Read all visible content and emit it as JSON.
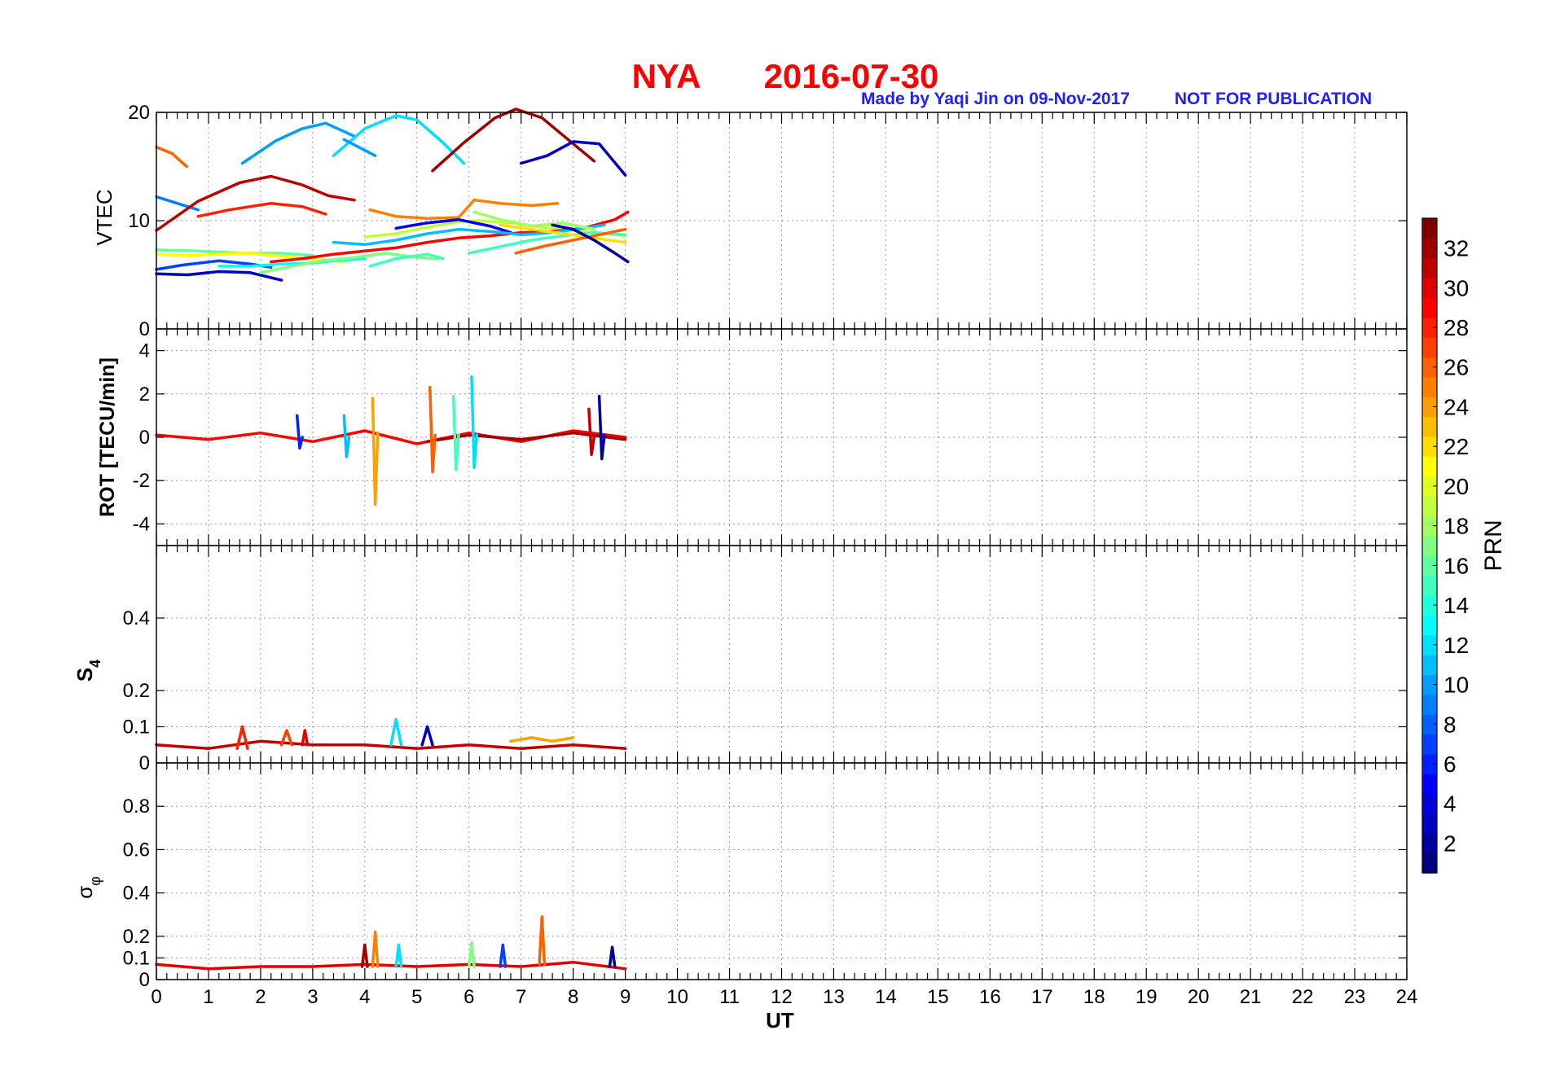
{
  "title": {
    "station": "NYA",
    "date": "2016-07-30",
    "credit": "Made by Yaqi Jin on 09-Nov-2017",
    "notice": "NOT FOR PUBLICATION",
    "color": "#ff0000",
    "credit_color": "#1f1fff"
  },
  "chart_data": {
    "type": "line",
    "x_axis": {
      "label": "UT",
      "range": [
        0,
        24
      ],
      "ticks": [
        0,
        1,
        2,
        3,
        4,
        5,
        6,
        7,
        8,
        9,
        10,
        11,
        12,
        13,
        14,
        15,
        16,
        17,
        18,
        19,
        20,
        21,
        22,
        23,
        24
      ],
      "data_coverage": [
        0,
        9.1
      ]
    },
    "grid": true,
    "colorbar": {
      "label": "PRN",
      "range": [
        1,
        33
      ],
      "ticks": [
        2,
        4,
        6,
        8,
        10,
        12,
        14,
        16,
        18,
        20,
        22,
        24,
        26,
        28,
        30,
        32
      ],
      "colormap": "jet",
      "position": "right"
    },
    "panels": [
      {
        "id": "vtec",
        "ylabel": "VTEC",
        "ylim": [
          0,
          20
        ],
        "yticks": [
          0,
          10,
          20
        ],
        "series": [
          {
            "prn": 26,
            "x": [
              0,
              0.3,
              0.58
            ],
            "y": [
              16.8,
              16.2,
              15.0
            ]
          },
          {
            "prn": 9,
            "x": [
              0,
              0.4,
              0.8
            ],
            "y": [
              12.2,
              11.6,
              11.0
            ]
          },
          {
            "prn": 28,
            "x": [
              0.8,
              1.4,
              2.2,
              2.8,
              3.25
            ],
            "y": [
              10.4,
              11.0,
              11.6,
              11.3,
              10.6
            ]
          },
          {
            "prn": 31,
            "x": [
              0,
              0.8,
              1.6,
              2.2,
              2.8,
              3.3,
              3.8
            ],
            "y": [
              9.1,
              11.8,
              13.5,
              14.1,
              13.3,
              12.3,
              11.9
            ]
          },
          {
            "prn": 10,
            "x": [
              1.65,
              2.3,
              2.8,
              3.25,
              3.8
            ],
            "y": [
              15.3,
              17.4,
              18.5,
              19.0,
              17.8
            ]
          },
          {
            "prn": 12,
            "x": [
              3.4,
              4.0,
              4.6,
              5.0,
              5.5,
              5.9
            ],
            "y": [
              16.0,
              18.5,
              19.7,
              19.3,
              17.2,
              15.3
            ]
          },
          {
            "prn": 10,
            "x": [
              3.6,
              4.2
            ],
            "y": [
              17.5,
              16.0
            ]
          },
          {
            "prn": 32,
            "x": [
              5.3,
              5.9,
              6.5,
              6.9,
              7.4,
              7.9,
              8.4
            ],
            "y": [
              14.6,
              17.2,
              19.5,
              20.3,
              19.5,
              17.5,
              15.5
            ]
          },
          {
            "prn": 3,
            "x": [
              7.0,
              7.5,
              8.0,
              8.5,
              9.0
            ],
            "y": [
              15.3,
              16.0,
              17.3,
              17.1,
              14.2
            ]
          },
          {
            "prn": 25,
            "x": [
              4.1,
              4.6,
              5.2,
              5.8,
              6.1,
              6.6,
              7.2,
              7.7
            ],
            "y": [
              11.0,
              10.4,
              10.2,
              10.3,
              11.9,
              11.6,
              11.4,
              11.6
            ]
          },
          {
            "prn": 19,
            "x": [
              4.0,
              4.6,
              5.2,
              5.8,
              6.2,
              6.8,
              7.4,
              8.0,
              8.6,
              9.0
            ],
            "y": [
              8.5,
              8.8,
              9.4,
              9.9,
              10.0,
              9.8,
              9.4,
              9.1,
              8.8,
              8.6
            ]
          },
          {
            "prn": 5,
            "x": [
              4.6,
              5.2,
              5.8,
              6.4,
              6.8
            ],
            "y": [
              9.3,
              9.8,
              10.1,
              9.5,
              8.9
            ]
          },
          {
            "prn": 16,
            "x": [
              0,
              0.8,
              1.6,
              2.4,
              3.0
            ],
            "y": [
              7.3,
              7.2,
              7.0,
              7.0,
              6.8
            ]
          },
          {
            "prn": 21,
            "x": [
              0,
              0.6,
              1.2,
              1.8,
              2.4,
              3.0,
              3.6
            ],
            "y": [
              6.9,
              6.8,
              6.9,
              7.0,
              6.7,
              6.5,
              6.2
            ]
          },
          {
            "prn": 7,
            "x": [
              0,
              0.5,
              1.2,
              1.8,
              2.2
            ],
            "y": [
              5.5,
              5.9,
              6.3,
              6.0,
              5.7
            ]
          },
          {
            "prn": 3,
            "x": [
              0,
              0.6,
              1.2,
              1.8,
              2.4
            ],
            "y": [
              5.1,
              5.0,
              5.3,
              5.2,
              4.5
            ]
          },
          {
            "prn": 13,
            "x": [
              1.2,
              1.8,
              2.4,
              3.0,
              3.4,
              4.0
            ],
            "y": [
              5.8,
              5.8,
              6.0,
              6.1,
              6.3,
              6.5
            ]
          },
          {
            "prn": 17,
            "x": [
              2.0,
              2.6,
              3.2,
              3.8,
              4.4,
              5.0,
              5.4
            ],
            "y": [
              5.2,
              5.8,
              6.3,
              6.6,
              7.0,
              6.6,
              6.5
            ]
          },
          {
            "prn": 29,
            "x": [
              2.2,
              2.8,
              3.4,
              4.0,
              4.6,
              5.2,
              5.8,
              6.4,
              7.0,
              7.6,
              8.2,
              8.8,
              9.05
            ],
            "y": [
              6.2,
              6.5,
              6.9,
              7.2,
              7.5,
              8.0,
              8.4,
              8.6,
              8.9,
              9.0,
              9.3,
              10.1,
              10.8
            ]
          },
          {
            "prn": 11,
            "x": [
              3.4,
              4.0,
              4.6,
              5.2,
              5.8,
              6.4,
              7.0,
              7.6,
              8.2,
              8.6
            ],
            "y": [
              8.0,
              7.8,
              8.2,
              8.8,
              9.2,
              9.0,
              8.7,
              8.9,
              9.3,
              9.6
            ]
          },
          {
            "prn": 15,
            "x": [
              6.0,
              6.6,
              7.2,
              7.8,
              8.4,
              9.0
            ],
            "y": [
              7.0,
              7.6,
              8.2,
              8.6,
              8.9,
              8.7
            ]
          },
          {
            "prn": 18,
            "x": [
              6.1,
              6.6,
              7.2,
              7.8,
              8.4
            ],
            "y": [
              10.8,
              10.1,
              9.5,
              9.8,
              9.2
            ]
          },
          {
            "prn": 22,
            "x": [
              6.6,
              7.2,
              7.8,
              8.4,
              9.0
            ],
            "y": [
              9.6,
              9.2,
              8.8,
              8.4,
              8.0
            ]
          },
          {
            "prn": 26,
            "x": [
              6.9,
              7.4,
              8.0,
              8.6,
              9.0
            ],
            "y": [
              7.0,
              7.6,
              8.2,
              8.8,
              9.2
            ]
          },
          {
            "prn": 2,
            "x": [
              7.6,
              8.0,
              8.4,
              8.8,
              9.05
            ],
            "y": [
              9.6,
              9.2,
              8.2,
              7.0,
              6.2
            ]
          },
          {
            "prn": 15,
            "x": [
              4.1,
              4.6,
              5.2,
              5.5
            ],
            "y": [
              5.8,
              6.5,
              6.9,
              6.5
            ]
          }
        ]
      },
      {
        "id": "rot",
        "ylabel": "ROT [TECU/min]",
        "ylim": [
          -5,
          5
        ],
        "yticks": [
          -4,
          -2,
          0,
          2,
          4
        ],
        "series": [
          {
            "prn": 29,
            "x": [
              0,
              1,
              2,
              3,
              4,
              5,
              6,
              7,
              8,
              9
            ],
            "y": [
              0.1,
              -0.1,
              0.2,
              -0.2,
              0.3,
              -0.3,
              0.2,
              -0.2,
              0.3,
              0.0
            ]
          },
          {
            "prn": 32,
            "x": [
              5.2,
              6,
              7,
              8,
              9
            ],
            "y": [
              -0.2,
              0.1,
              -0.1,
              0.2,
              -0.1
            ]
          },
          {
            "prn": 24,
            "x": [
              4.15,
              4.2,
              4.25
            ],
            "y": [
              1.8,
              -3.1,
              0.2
            ]
          },
          {
            "prn": 26,
            "x": [
              5.25,
              5.3,
              5.35
            ],
            "y": [
              2.3,
              -1.6,
              0.1
            ]
          },
          {
            "prn": 12,
            "x": [
              6.05,
              6.1,
              6.15
            ],
            "y": [
              2.8,
              -1.4,
              0.1
            ]
          },
          {
            "prn": 15,
            "x": [
              5.7,
              5.75,
              5.8
            ],
            "y": [
              1.9,
              -1.5,
              0.1
            ]
          },
          {
            "prn": 2,
            "x": [
              8.5,
              8.55,
              8.6
            ],
            "y": [
              1.9,
              -1.0,
              0.1
            ]
          },
          {
            "prn": 31,
            "x": [
              8.3,
              8.35,
              8.4
            ],
            "y": [
              1.3,
              -0.8,
              0.0
            ]
          },
          {
            "prn": 11,
            "x": [
              3.6,
              3.65,
              3.7
            ],
            "y": [
              1.0,
              -0.9,
              0.0
            ]
          },
          {
            "prn": 6,
            "x": [
              2.7,
              2.75,
              2.8
            ],
            "y": [
              1.0,
              -0.5,
              0.0
            ]
          }
        ]
      },
      {
        "id": "s4",
        "ylabel_main": "S",
        "ylabel_sub": "4",
        "ylim": [
          0,
          0.6
        ],
        "yticks": [
          0,
          0.1,
          0.2,
          0.4
        ],
        "series": [
          {
            "prn": 31,
            "x": [
              0,
              1,
              2,
              3,
              4,
              5,
              6,
              7,
              8,
              9
            ],
            "y": [
              0.05,
              0.04,
              0.06,
              0.05,
              0.05,
              0.04,
              0.05,
              0.04,
              0.05,
              0.04
            ]
          },
          {
            "prn": 28,
            "x": [
              1.55,
              1.65,
              1.75
            ],
            "y": [
              0.04,
              0.1,
              0.04
            ]
          },
          {
            "prn": 12,
            "x": [
              4.5,
              4.6,
              4.7
            ],
            "y": [
              0.05,
              0.12,
              0.05
            ]
          },
          {
            "prn": 3,
            "x": [
              5.1,
              5.2,
              5.3
            ],
            "y": [
              0.05,
              0.1,
              0.05
            ]
          },
          {
            "prn": 27,
            "x": [
              2.4,
              2.5,
              2.6
            ],
            "y": [
              0.05,
              0.09,
              0.05
            ]
          },
          {
            "prn": 30,
            "x": [
              2.8,
              2.85,
              2.9
            ],
            "y": [
              0.05,
              0.09,
              0.05
            ]
          },
          {
            "prn": 24,
            "x": [
              6.8,
              7.2,
              7.6,
              8.0
            ],
            "y": [
              0.06,
              0.07,
              0.06,
              0.07
            ]
          }
        ]
      },
      {
        "id": "sigma_phi",
        "ylabel_main": "σ",
        "ylabel_sub": "φ",
        "ylim": [
          0,
          1
        ],
        "yticks": [
          0,
          0.1,
          0.2,
          0.4,
          0.6,
          0.8
        ],
        "series": [
          {
            "prn": 30,
            "x": [
              0,
              1,
              2,
              3,
              4,
              5,
              6,
              7,
              8,
              9
            ],
            "y": [
              0.07,
              0.05,
              0.06,
              0.06,
              0.07,
              0.06,
              0.07,
              0.06,
              0.08,
              0.05
            ]
          },
          {
            "prn": 25,
            "x": [
              4.15,
              4.2,
              4.25
            ],
            "y": [
              0.06,
              0.22,
              0.06
            ]
          },
          {
            "prn": 26,
            "x": [
              7.35,
              7.4,
              7.45
            ],
            "y": [
              0.07,
              0.29,
              0.07
            ]
          },
          {
            "prn": 32,
            "x": [
              3.95,
              4.0,
              4.05
            ],
            "y": [
              0.06,
              0.16,
              0.06
            ]
          },
          {
            "prn": 17,
            "x": [
              6.0,
              6.05,
              6.1
            ],
            "y": [
              0.06,
              0.17,
              0.06
            ]
          },
          {
            "prn": 12,
            "x": [
              4.6,
              4.65,
              4.7
            ],
            "y": [
              0.06,
              0.16,
              0.06
            ]
          },
          {
            "prn": 2,
            "x": [
              8.7,
              8.75,
              8.8
            ],
            "y": [
              0.06,
              0.15,
              0.06
            ]
          },
          {
            "prn": 7,
            "x": [
              6.6,
              6.65,
              6.7
            ],
            "y": [
              0.06,
              0.16,
              0.06
            ]
          }
        ]
      }
    ]
  }
}
